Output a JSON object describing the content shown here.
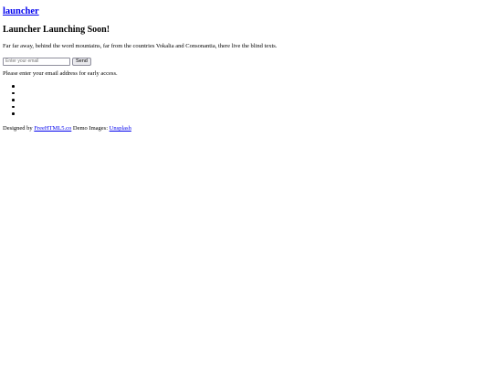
{
  "header": {
    "brand": "launcher"
  },
  "hero": {
    "title": "Launcher Launching Soon!",
    "tagline": "Far far away, behind the word mountains, far from the countries Vokalia and Consonantia, there live the blind texts."
  },
  "signup": {
    "email_placeholder": "Enter your email",
    "email_value": "",
    "send_label": "Send",
    "note": "Please enter your email address for early access."
  },
  "social": {
    "items": [
      {
        "label": "",
        "icon": "bullet-icon"
      },
      {
        "label": "",
        "icon": "bullet-icon"
      },
      {
        "label": "",
        "icon": "bullet-icon"
      },
      {
        "label": "",
        "icon": "bullet-icon"
      },
      {
        "label": "",
        "icon": "bullet-icon"
      }
    ]
  },
  "footer": {
    "designed_by_prefix": "Designed by",
    "designer_link": "FreeHTML5.co",
    "images_prefix": "Demo Images:",
    "images_link": "Unsplash"
  },
  "colors": {
    "link": "#0000ee",
    "text": "#000000",
    "background": "#ffffff"
  }
}
